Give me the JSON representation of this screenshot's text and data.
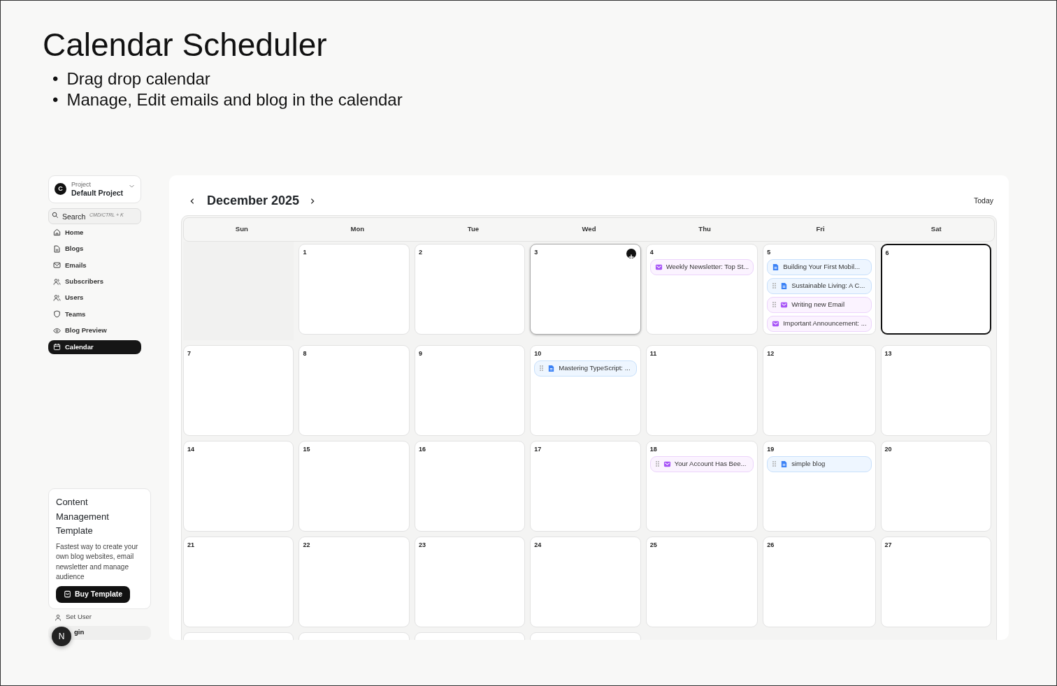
{
  "heading": {
    "title": "Calendar Scheduler",
    "marker": "•",
    "bullets": [
      "Drag drop calendar",
      "Manage, Edit emails and blog in the calendar"
    ]
  },
  "sidebar": {
    "project": {
      "avatar": "C",
      "label": "Project",
      "name": "Default Project"
    },
    "search": {
      "placeholder": "Search",
      "shortcut": "CMD/CTRL + K"
    },
    "items": [
      {
        "label": "Home",
        "selected": false
      },
      {
        "label": "Blogs",
        "selected": false
      },
      {
        "label": "Emails",
        "selected": false
      },
      {
        "label": "Subscribers",
        "selected": false
      },
      {
        "label": "Users",
        "selected": false
      },
      {
        "label": "Teams",
        "selected": false
      },
      {
        "label": "Blog Preview",
        "selected": false
      },
      {
        "label": "Calendar",
        "selected": true
      }
    ],
    "promo": {
      "title": "Content Management Template",
      "text": "Fastest way to create your own blog websites, email newsletter and manage audience",
      "button": "Buy Template"
    },
    "footer": [
      {
        "label": "Set User",
        "kind": "user"
      },
      {
        "label": "gin",
        "kind": "login",
        "badge": "N"
      }
    ]
  },
  "calendar": {
    "month": "December 2025",
    "today_button": "Today",
    "weekdays": [
      "Sun",
      "Mon",
      "Tue",
      "Wed",
      "Thu",
      "Fri",
      "Sat"
    ],
    "weeks": [
      [
        {
          "kind": "outside"
        },
        {
          "day": "1"
        },
        {
          "day": "2"
        },
        {
          "day": "3",
          "hovered": true
        },
        {
          "day": "4",
          "events": [
            {
              "kind": "email",
              "title": "Weekly Newsletter: Top St...",
              "draggable": false
            }
          ]
        },
        {
          "day": "5",
          "events": [
            {
              "kind": "blog",
              "title": "Building Your First Mobil...",
              "draggable": false
            },
            {
              "kind": "blog",
              "title": "Sustainable Living: A C...",
              "draggable": true
            },
            {
              "kind": "email",
              "title": "Writing new Email",
              "draggable": true
            },
            {
              "kind": "email",
              "title": "Important Announcement: ...",
              "draggable": false
            }
          ]
        },
        {
          "day": "6",
          "today": true
        }
      ],
      [
        {
          "day": "7"
        },
        {
          "day": "8"
        },
        {
          "day": "9"
        },
        {
          "day": "10",
          "events": [
            {
              "kind": "blog",
              "title": "Mastering TypeScript: ...",
              "draggable": true
            }
          ]
        },
        {
          "day": "11"
        },
        {
          "day": "12"
        },
        {
          "day": "13"
        }
      ],
      [
        {
          "day": "14"
        },
        {
          "day": "15"
        },
        {
          "day": "16"
        },
        {
          "day": "17"
        },
        {
          "day": "18",
          "events": [
            {
              "kind": "email",
              "title": "Your Account Has Bee...",
              "draggable": true
            }
          ]
        },
        {
          "day": "19",
          "events": [
            {
              "kind": "blog",
              "title": "simple blog",
              "draggable": true
            }
          ]
        },
        {
          "day": "20"
        }
      ],
      [
        {
          "day": "21"
        },
        {
          "day": "22"
        },
        {
          "day": "23"
        },
        {
          "day": "24"
        },
        {
          "day": "25"
        },
        {
          "day": "26"
        },
        {
          "day": "27"
        }
      ],
      [
        {
          "kind": "cut"
        },
        {
          "kind": "cut"
        },
        {
          "kind": "cut"
        },
        {
          "kind": "cut"
        }
      ]
    ]
  }
}
